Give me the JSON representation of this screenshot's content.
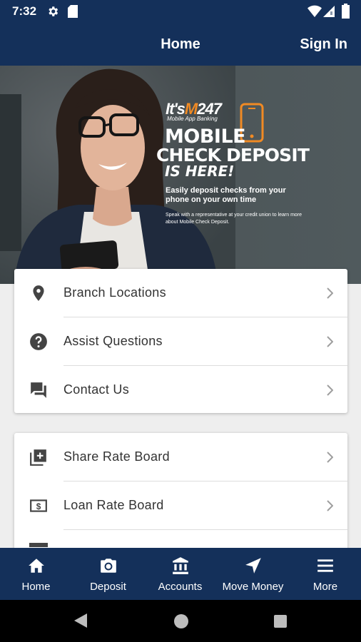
{
  "status_bar": {
    "time": "7:32"
  },
  "header": {
    "title": "Home",
    "sign_in": "Sign In"
  },
  "banner": {
    "brand": "It's",
    "brand_m": "M",
    "brand_num": "247",
    "brand_sub": "Mobile App Banking",
    "line1": "MOBILE",
    "line2": "CHECK DEPOSIT",
    "line3": "IS HERE!",
    "body": "Easily deposit checks from your phone on your own time",
    "small": "Speak with a representative at your credit union to learn more about Mobile Check Deposit."
  },
  "menu1": [
    {
      "label": "Branch Locations",
      "icon": "location-pin-icon"
    },
    {
      "label": "Assist Questions",
      "icon": "help-circle-icon"
    },
    {
      "label": "Contact Us",
      "icon": "chat-bubbles-icon"
    }
  ],
  "menu2": [
    {
      "label": "Share Rate Board",
      "icon": "add-box-icon"
    },
    {
      "label": "Loan Rate Board",
      "icon": "dollar-box-icon"
    }
  ],
  "bottom_nav": [
    {
      "label": "Home",
      "icon": "home-icon"
    },
    {
      "label": "Deposit",
      "icon": "camera-icon"
    },
    {
      "label": "Accounts",
      "icon": "bank-icon"
    },
    {
      "label": "Move Money",
      "icon": "navigation-arrow-icon"
    },
    {
      "label": "More",
      "icon": "menu-icon"
    }
  ],
  "colors": {
    "primary": "#14305a",
    "accent": "#f08a24",
    "background": "#eeeeee"
  }
}
